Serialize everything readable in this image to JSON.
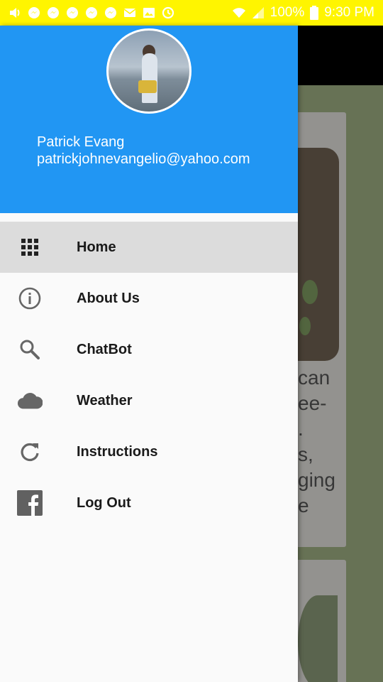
{
  "status_bar": {
    "battery": "100%",
    "time": "9:30 PM",
    "background": "#FFF500",
    "notification_icons": [
      "volume-icon",
      "messenger-icon",
      "messenger-icon",
      "messenger-icon",
      "messenger-icon",
      "messenger-icon",
      "mail-icon",
      "gallery-icon",
      "sync-icon"
    ]
  },
  "drawer": {
    "header_color": "#2196F3",
    "user": {
      "name": "Patrick Evang",
      "email": "patrickjohnevangelio@yahoo.com"
    },
    "items": [
      {
        "label": "Home",
        "icon": "grid-icon",
        "active": true
      },
      {
        "label": "About Us",
        "icon": "info-icon",
        "active": false
      },
      {
        "label": "ChatBot",
        "icon": "search-icon",
        "active": false
      },
      {
        "label": "Weather",
        "icon": "cloud-icon",
        "active": false
      },
      {
        "label": "Instructions",
        "icon": "refresh-icon",
        "active": false
      },
      {
        "label": "Log Out",
        "icon": "facebook-icon",
        "active": false
      }
    ]
  },
  "background": {
    "card_text_fragments": [
      "can",
      "ee-",
      ".",
      "s,",
      "ging",
      "e"
    ]
  }
}
